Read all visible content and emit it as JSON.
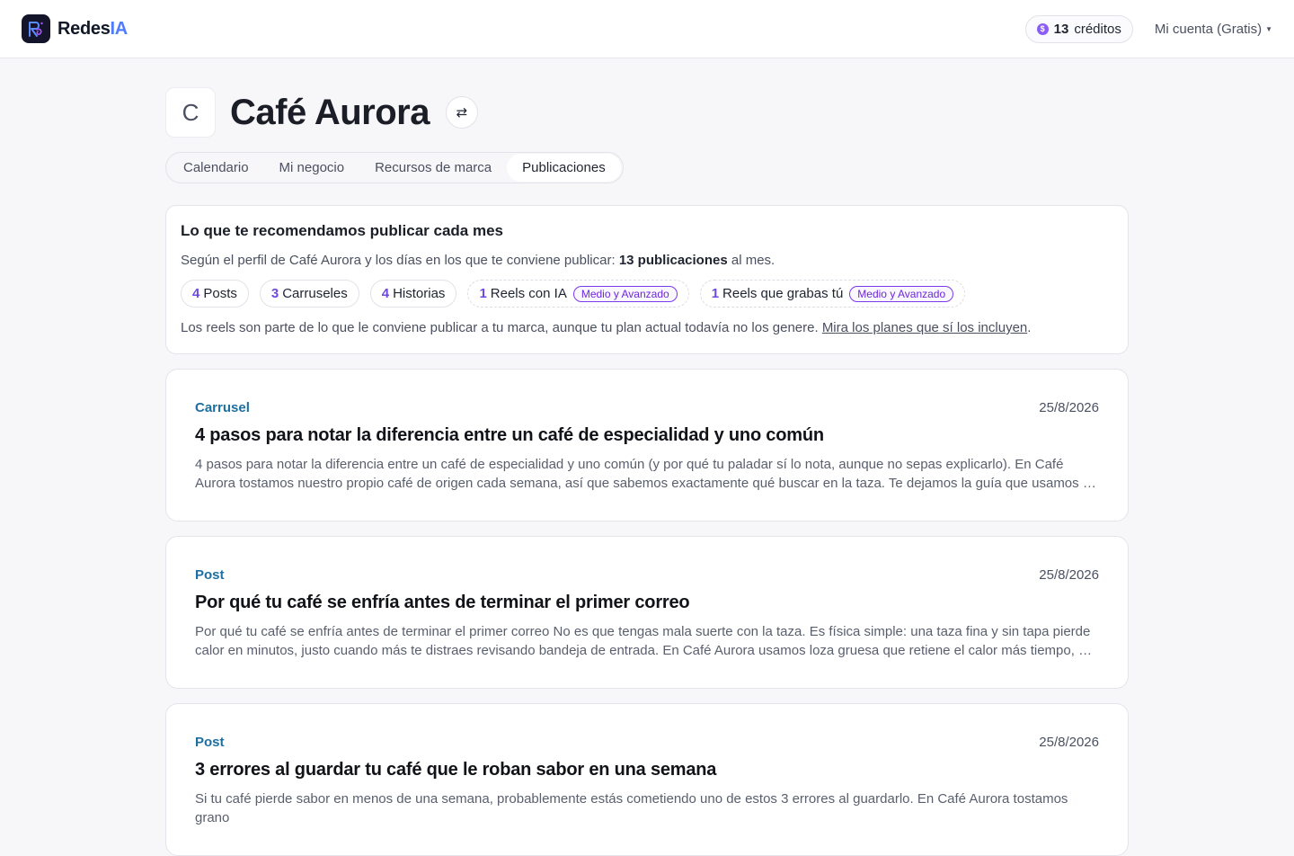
{
  "brand": {
    "name_prefix": "Redes",
    "name_suffix": "IA",
    "logo_icon": "redesia-logo-icon"
  },
  "header": {
    "credits_count": "13",
    "credits_label": "créditos",
    "account_label": "Mi cuenta (Gratis)"
  },
  "business": {
    "avatar_letter": "C",
    "name": "Café Aurora",
    "switch_icon": "swap-arrows-icon"
  },
  "tabs": [
    {
      "label": "Calendario",
      "active": false
    },
    {
      "label": "Mi negocio",
      "active": false
    },
    {
      "label": "Recursos de marca",
      "active": false
    },
    {
      "label": "Publicaciones",
      "active": true
    }
  ],
  "recommendation": {
    "title": "Lo que te recomendamos publicar cada mes",
    "desc_prefix": "Según el perfil de Café Aurora y los días en los que te conviene publicar:",
    "desc_bold": "13 publicaciones",
    "desc_suffix": "al mes.",
    "chips": [
      {
        "num": "4",
        "label": "Posts",
        "tag": ""
      },
      {
        "num": "3",
        "label": "Carruseles",
        "tag": ""
      },
      {
        "num": "4",
        "label": "Historias",
        "tag": ""
      },
      {
        "num": "1",
        "label": "Reels con IA",
        "tag": "Medio y Avanzado"
      },
      {
        "num": "1",
        "label": "Reels que grabas tú",
        "tag": "Medio y Avanzado"
      }
    ],
    "note": "Los reels son parte de lo que le conviene publicar a tu marca, aunque tu plan actual todavía no los genere.",
    "note_link": "Mira los planes que sí los incluyen",
    "note_end": "."
  },
  "posts": [
    {
      "type": "Carrusel",
      "date": "25/8/2026",
      "title": "4 pasos para notar la diferencia entre un café de especialidad y uno común",
      "excerpt": "4 pasos para notar la diferencia entre un café de especialidad y uno común (y por qué tu paladar sí lo nota, aunque no sepas explicarlo). En Café Aurora tostamos nuestro propio café de origen cada semana, así que sabemos exactamente qué buscar en la taza. Te dejamos la guía que usamos en nuestra barra."
    },
    {
      "type": "Post",
      "date": "25/8/2026",
      "title": "Por qué tu café se enfría antes de terminar el primer correo",
      "excerpt": "Por qué tu café se enfría antes de terminar el primer correo No es que tengas mala suerte con la taza. Es física simple: una taza fina y sin tapa pierde calor en minutos, justo cuando más te distraes revisando bandeja de entrada. En Café Aurora usamos loza gruesa que retiene el calor más tiempo, así que tu café dura caliente."
    },
    {
      "type": "Post",
      "date": "25/8/2026",
      "title": "3 errores al guardar tu café que le roban sabor en una semana",
      "excerpt": "Si tu café pierde sabor en menos de una semana, probablemente estás cometiendo uno de estos 3 errores al guardarlo. En Café Aurora tostamos grano"
    }
  ]
}
